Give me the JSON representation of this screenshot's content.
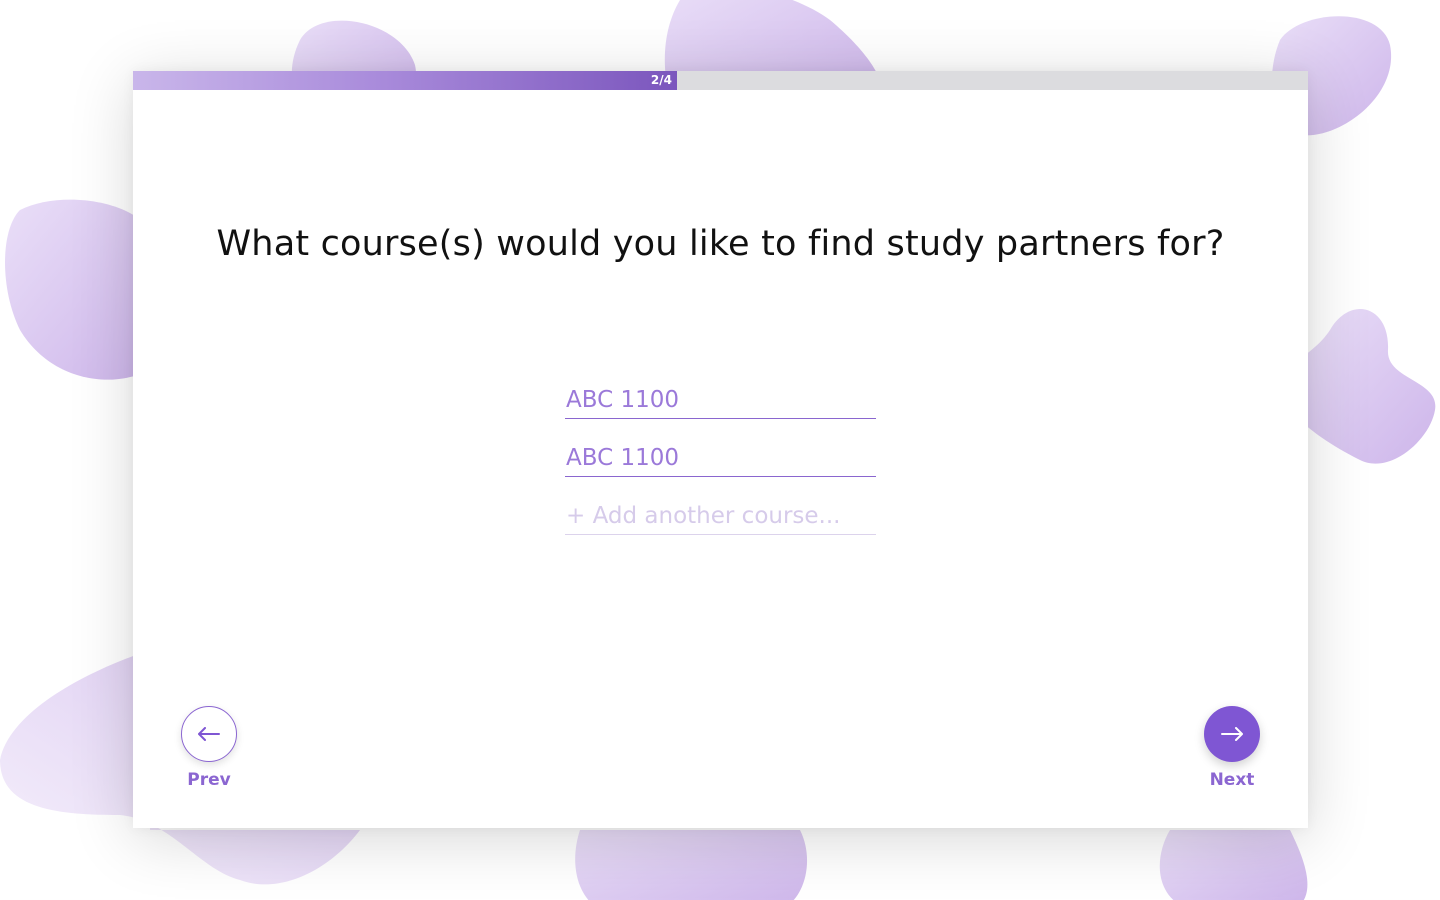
{
  "progress": {
    "label": "2/4",
    "fraction": 0.463,
    "fill_color": "#7b56bd",
    "track_color": "#dcdcdf"
  },
  "question": {
    "text": "What course(s) would you like to find study partners for?"
  },
  "courses": {
    "items": [
      "ABC 1100",
      "ABC 1100"
    ],
    "add_placeholder": "+ Add another course..."
  },
  "navigation": {
    "prev_label": "Prev",
    "next_label": "Next",
    "prev_icon": "arrow-left-icon",
    "next_icon": "arrow-right-icon"
  },
  "colors": {
    "accent": "#7f56d3",
    "blob": "#d9c6f0"
  }
}
